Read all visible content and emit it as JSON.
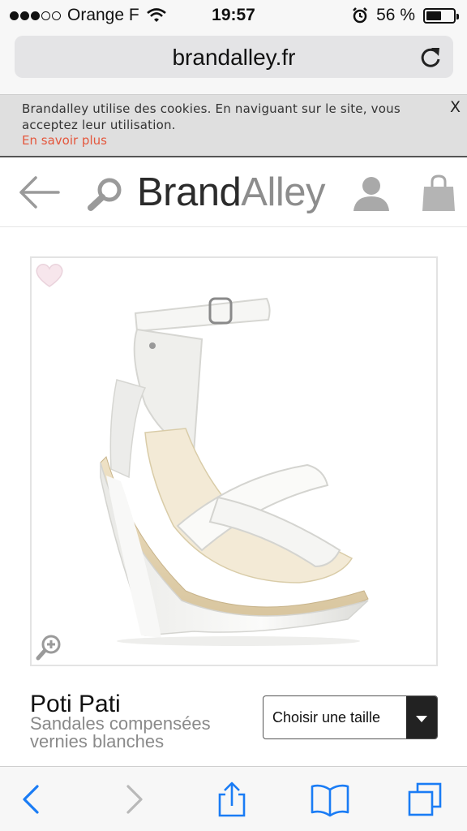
{
  "status_bar": {
    "carrier": "Orange F",
    "signal_bars_filled": 3,
    "signal_bars_total": 5,
    "time": "19:57",
    "battery_percent_label": "56 %",
    "battery_level": 0.56
  },
  "browser": {
    "url": "brandalley.fr"
  },
  "cookie_banner": {
    "text": "Brandalley utilise des cookies. En naviguant sur le site, vous acceptez leur utilisation.",
    "link": "En savoir plus",
    "close_label": "X"
  },
  "header": {
    "logo_brand": "Brand",
    "logo_alley": "Alley"
  },
  "product": {
    "name": "Poti Pati",
    "description": "Sandales compensées vernies blanches",
    "size_select": {
      "label": "Choisir une taille"
    }
  },
  "colors": {
    "accent": "#e4573d",
    "logo_dark": "#2b2b2b",
    "logo_light": "#8d8d8d",
    "ios_blue": "#1a7cf5"
  }
}
